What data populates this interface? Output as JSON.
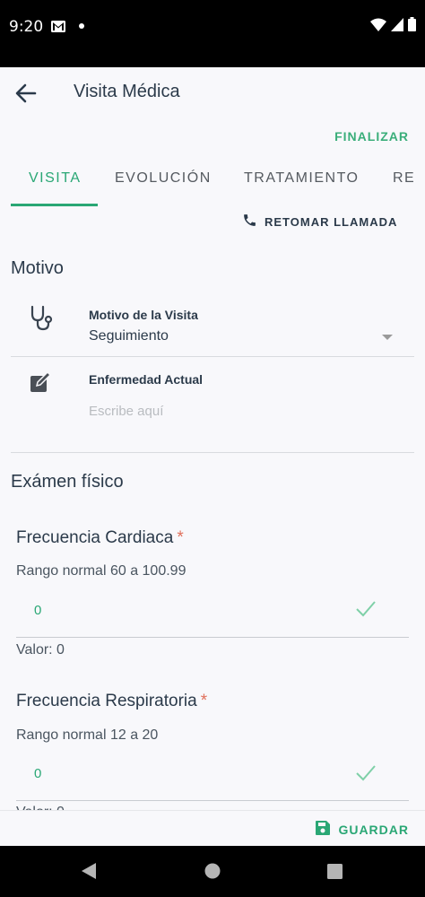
{
  "status_bar": {
    "time": "9:20"
  },
  "app_bar": {
    "title": "Visita Médica"
  },
  "actions": {
    "finalizar": "FINALIZAR",
    "retomar": "RETOMAR LLAMADA",
    "guardar": "GUARDAR"
  },
  "tabs": [
    {
      "label": "VISITA",
      "active": true
    },
    {
      "label": "EVOLUCIÓN",
      "active": false
    },
    {
      "label": "TRATAMIENTO",
      "active": false
    },
    {
      "label": "RE",
      "active": false
    }
  ],
  "motivo": {
    "title": "Motivo",
    "visita_label": "Motivo de la Visita",
    "visita_value": "Seguimiento",
    "enfermedad_label": "Enfermedad Actual",
    "enfermedad_placeholder": "Escribe aquí"
  },
  "examen": {
    "title": "Exámen físico",
    "required_mark": "*",
    "vitals": [
      {
        "title": "Frecuencia Cardiaca",
        "range": "Rango normal 60 a 100.99",
        "input": "0",
        "valor": "Valor: 0"
      },
      {
        "title": "Frecuencia Respiratoria",
        "range": "Rango normal 12 a 20",
        "input": "0",
        "valor": "Valor: 0"
      }
    ]
  },
  "colors": {
    "accent": "#2aa775",
    "text": "#2b3a4a",
    "required": "#e0705b"
  }
}
